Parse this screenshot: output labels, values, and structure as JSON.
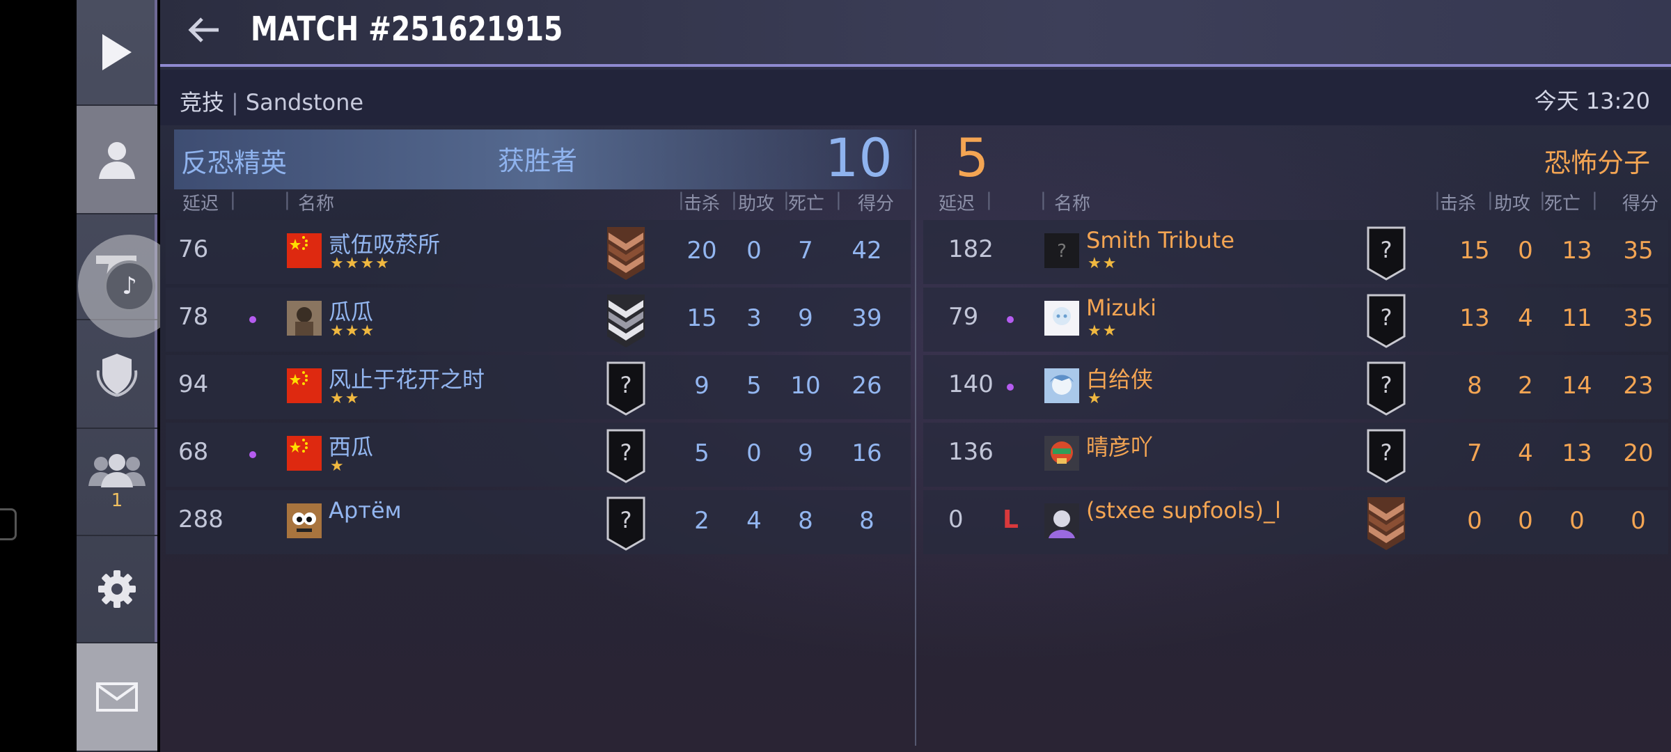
{
  "header": {
    "title": "MATCH #251621915"
  },
  "match": {
    "mode": "竞技",
    "separator": "|",
    "map": "Sandstone",
    "time": "今天 13:20"
  },
  "sidebar": {
    "items": [
      {
        "icon": "play-icon"
      },
      {
        "icon": "profile-icon"
      },
      {
        "icon": "pistol-icon"
      },
      {
        "icon": "rank-shield-icon"
      },
      {
        "icon": "friends-icon",
        "badge": "1"
      },
      {
        "icon": "gear-icon"
      },
      {
        "icon": "mail-icon"
      }
    ],
    "floating_bubble_icon": "tiktok-icon"
  },
  "teams": {
    "ct": {
      "name": "反恐精英",
      "result": "获胜者",
      "score": "10",
      "color": "#93b6f0"
    },
    "t": {
      "name": "恐怖分子",
      "score": "5",
      "color": "#f4a553"
    }
  },
  "columns": {
    "ping": "延迟",
    "name": "名称",
    "kills": "击杀",
    "assists": "助攻",
    "deaths": "死亡",
    "score": "得分"
  },
  "ct_players": [
    {
      "ping": "76",
      "name": "贰伍吸菸所",
      "stars": "★★★★",
      "kills": "20",
      "assists": "0",
      "deaths": "7",
      "score": "42",
      "rank": "bronze",
      "avatar": "cn-flag",
      "dot": false
    },
    {
      "ping": "78",
      "name": "瓜瓜",
      "stars": "★★★",
      "kills": "15",
      "assists": "3",
      "deaths": "9",
      "score": "39",
      "rank": "silver",
      "avatar": "photo",
      "dot": true
    },
    {
      "ping": "94",
      "name": "风止于花开之时",
      "stars": "★★",
      "kills": "9",
      "assists": "5",
      "deaths": "10",
      "score": "26",
      "rank": "unknown",
      "avatar": "cn-flag",
      "dot": false
    },
    {
      "ping": "68",
      "name": "西瓜",
      "stars": "★",
      "kills": "5",
      "assists": "0",
      "deaths": "9",
      "score": "16",
      "rank": "unknown",
      "avatar": "cn-flag",
      "dot": true
    },
    {
      "ping": "288",
      "name": "Артём",
      "stars": "",
      "kills": "2",
      "assists": "4",
      "deaths": "8",
      "score": "8",
      "rank": "unknown",
      "avatar": "cartoon",
      "dot": false
    }
  ],
  "t_players": [
    {
      "ping": "182",
      "name": "Smith Tribute",
      "stars": "★★",
      "kills": "15",
      "assists": "0",
      "deaths": "13",
      "score": "35",
      "rank": "unknown",
      "avatar": "unknown",
      "dot": false,
      "mark": ""
    },
    {
      "ping": "79",
      "name": "Mizuki",
      "stars": "★★",
      "kills": "13",
      "assists": "4",
      "deaths": "11",
      "score": "35",
      "rank": "unknown",
      "avatar": "anime",
      "dot": true,
      "mark": ""
    },
    {
      "ping": "140",
      "name": "白给侠",
      "stars": "★",
      "kills": "8",
      "assists": "2",
      "deaths": "14",
      "score": "23",
      "rank": "unknown",
      "avatar": "anime-blue",
      "dot": true,
      "mark": ""
    },
    {
      "ping": "136",
      "name": "晴彦吖",
      "stars": "",
      "kills": "7",
      "assists": "4",
      "deaths": "13",
      "score": "20",
      "rank": "unknown",
      "avatar": "game-char",
      "dot": false,
      "mark": ""
    },
    {
      "ping": "0",
      "name": "(stxee supfools)_l",
      "stars": "",
      "kills": "0",
      "assists": "0",
      "deaths": "0",
      "score": "0",
      "rank": "bronze",
      "avatar": "dark-char",
      "dot": false,
      "mark": "L"
    }
  ]
}
